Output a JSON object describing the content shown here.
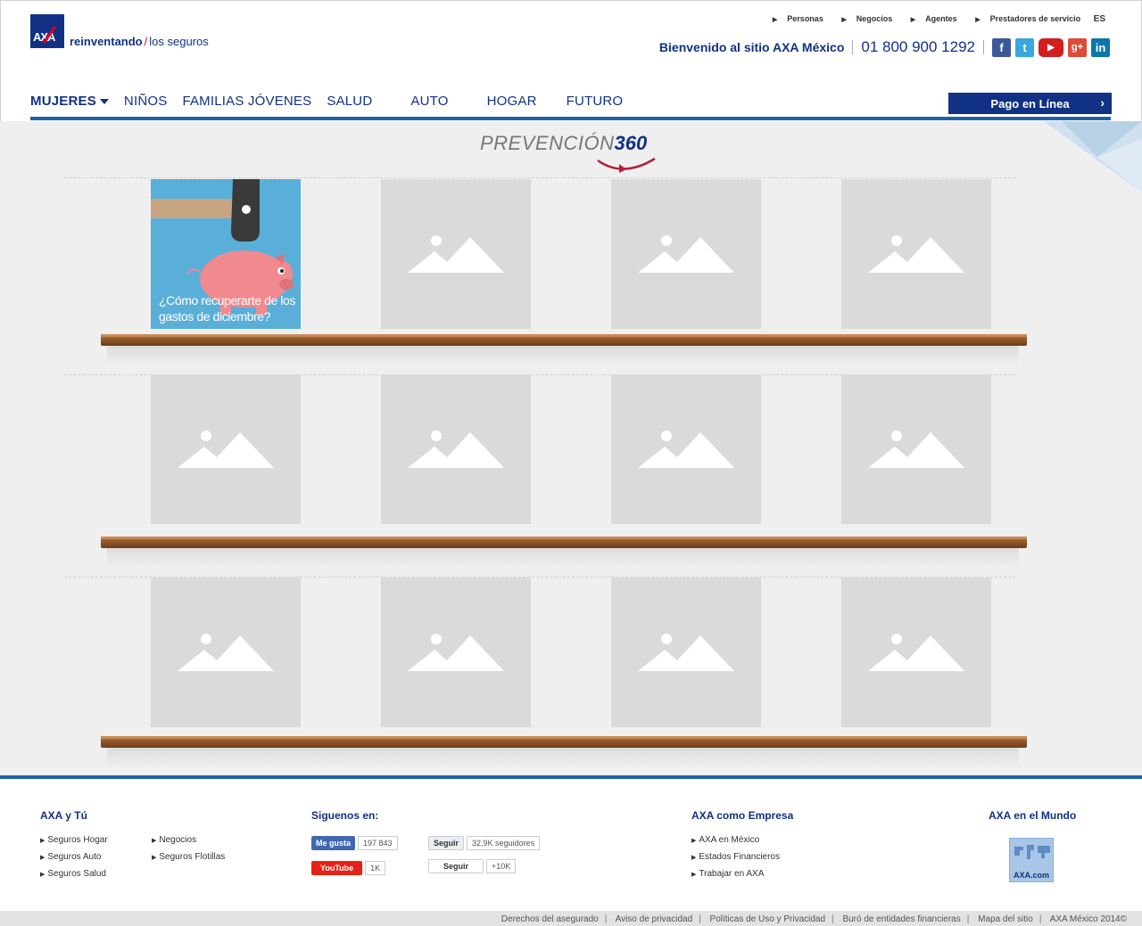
{
  "header": {
    "tagline_bold": "reinventando",
    "tagline_slash": "/",
    "tagline_rest": "los seguros",
    "top_links": [
      "Personas",
      "Negocios",
      "Agentes",
      "Prestadores de servicio"
    ],
    "language": "ES",
    "welcome": "Bienvenido al sitio AXA México",
    "phone": "01 800 900 1292",
    "social_icons": [
      "facebook-icon",
      "twitter-icon",
      "youtube-icon",
      "google-plus-icon",
      "linkedin-icon"
    ]
  },
  "nav": {
    "items": [
      "MUJERES",
      "NIÑOS",
      "FAMILIAS JÓVENES",
      "SALUD",
      "AUTO",
      "HOGAR",
      "FUTURO"
    ],
    "pay_button": "Pago en Línea"
  },
  "main": {
    "title_light": "PREVENCIÓN",
    "title_bold": "360",
    "featured_caption": "¿Cómo recuperarte de los gastos de diciembre?"
  },
  "footer": {
    "axa_tu": {
      "title": "AXA y Tú",
      "links_col1": [
        "Seguros Hogar",
        "Seguros Auto",
        "Seguros Salud"
      ],
      "links_col2": [
        "Negocios",
        "Seguros Flotillas"
      ]
    },
    "social": {
      "title": "Siguenos en:",
      "facebook_label": "Me gusta",
      "facebook_count": "197 843",
      "twitter_label": "Seguir",
      "twitter_count": "32,9K seguidores",
      "youtube_label": "YouTube",
      "youtube_count": "1K",
      "google_label": "Seguir",
      "google_count": "+10K"
    },
    "empresa": {
      "title": "AXA como Empresa",
      "links": [
        "AXA en México",
        "Estados Financieros",
        "Trabajar en AXA"
      ]
    },
    "mundo": {
      "title": "AXA en el Mundo",
      "badge": "AXA.com"
    },
    "legal": [
      "Derechos del asegurado",
      "Aviso de privacidad",
      "Políticas de Uso y Privacidad",
      "Buró de entidades financieras",
      "Mapa del sitio",
      "AXA México 2014©"
    ]
  },
  "colors": {
    "brand_blue": "#103184",
    "accent_blue": "#1d63a8",
    "brand_red": "#e3001a"
  }
}
